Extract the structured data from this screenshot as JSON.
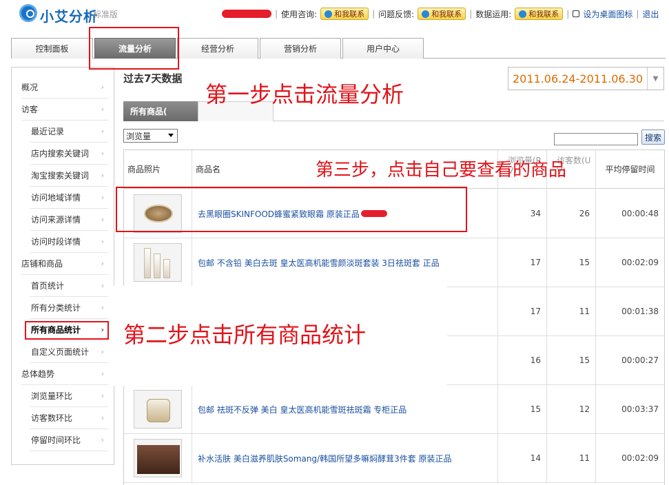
{
  "header": {
    "logo_text": "小艾分析",
    "edition": "标准版",
    "consult_label": "使用咨询:",
    "feedback_label": "问题反馈:",
    "data_label": "数据运用:",
    "contact_btn": "和我联系",
    "desktop_icon_label": "设为桌面图标",
    "logout": "退出"
  },
  "tabs": [
    {
      "label": "控制面板"
    },
    {
      "label": "流量分析"
    },
    {
      "label": "经营分析"
    },
    {
      "label": "营销分析"
    },
    {
      "label": "用户中心"
    }
  ],
  "sidebar": {
    "items": [
      {
        "label": "概况"
      },
      {
        "label": "访客"
      },
      {
        "label": "最近记录"
      },
      {
        "label": "店内搜索关键词"
      },
      {
        "label": "淘宝搜索关键词"
      },
      {
        "label": "访问地域详情"
      },
      {
        "label": "访问来源详情"
      },
      {
        "label": "访问时段详情"
      },
      {
        "label": "店铺和商品"
      },
      {
        "label": "首页统计"
      },
      {
        "label": "所有分类统计"
      },
      {
        "label": "所有商品统计"
      },
      {
        "label": "自定义页面统计"
      },
      {
        "label": "总体趋势"
      },
      {
        "label": "浏览量环比"
      },
      {
        "label": "访客数环比"
      },
      {
        "label": "停留时间环比"
      }
    ]
  },
  "main": {
    "title": "过去7天数据",
    "date_range": "2011.06.24-2011.06.30",
    "subtab": "所有商品(",
    "metric_select": "浏览量",
    "search_button": "搜索",
    "columns": {
      "image": "商品照片",
      "name": "商品名",
      "pv": "浏览量(P V)",
      "uv": "访客数(U V)",
      "stay": "平均停留时间"
    },
    "rows": [
      {
        "name": "去黑眼圈SKINFOOD蜂蜜紧致眼霜 原装正品",
        "pv": "34",
        "uv": "26",
        "stay": "00:00:48"
      },
      {
        "name": "包邮 不含铅 美白去斑 皇太医高机能雪颜淡斑套装 3日祛斑套 正品",
        "pv": "17",
        "uv": "15",
        "stay": "00:02:09"
      },
      {
        "name": "",
        "pv": "17",
        "uv": "11",
        "stay": "00:01:38"
      },
      {
        "name": "",
        "pv": "16",
        "uv": "15",
        "stay": "00:00:27"
      },
      {
        "name": "包邮 祛斑不反弹 美白 皇太医高机能雪斑祛斑霜 专柜正品",
        "pv": "15",
        "uv": "12",
        "stay": "00:03:37"
      },
      {
        "name": "补水活肤 美白滋养肌肤Somang/韩国所望多嘛焖酵茸3件套 原装正品",
        "pv": "14",
        "uv": "11",
        "stay": "00:02:09"
      }
    ]
  },
  "annotations": {
    "step1": "第一步点击流量分析",
    "step2": "第二步点击所有商品统计",
    "step3": "第三步，点击自己要查看的商品"
  },
  "colors": {
    "annotation": "#e0141a",
    "date_text": "#e06a00",
    "link": "#1a4fa0"
  }
}
